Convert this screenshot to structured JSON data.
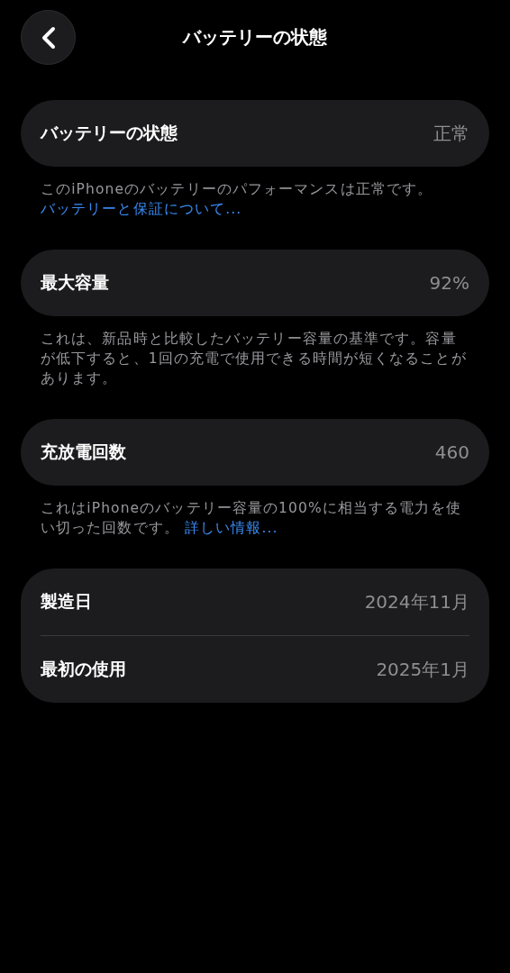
{
  "header": {
    "title": "バッテリーの状態"
  },
  "sections": [
    {
      "rows": [
        {
          "label": "バッテリーの状態",
          "value": "正常"
        }
      ],
      "footer": {
        "text": "このiPhoneのバッテリーのパフォーマンスは正常です。",
        "link": "バッテリーと保証について..."
      }
    },
    {
      "rows": [
        {
          "label": "最大容量",
          "value": "92%"
        }
      ],
      "footer": {
        "text": "これは、新品時と比較したバッテリー容量の基準です。容量が低下すると、1回の充電で使用できる時間が短くなることがあります。"
      }
    },
    {
      "rows": [
        {
          "label": "充放電回数",
          "value": "460"
        }
      ],
      "footer": {
        "text": "これはiPhoneのバッテリー容量の100%に相当する電力を使い切った回数です。",
        "link": "詳しい情報..."
      }
    },
    {
      "rows": [
        {
          "label": "製造日",
          "value": "2024年11月"
        },
        {
          "label": "最初の使用",
          "value": "2025年1月"
        }
      ]
    }
  ]
}
